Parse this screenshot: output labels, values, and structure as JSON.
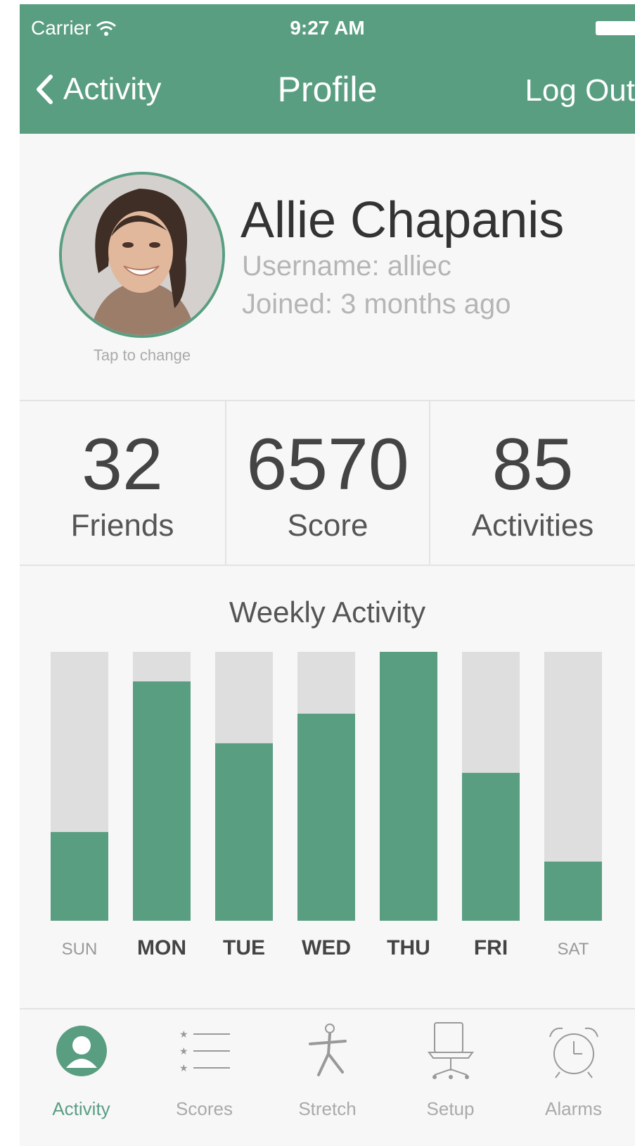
{
  "status_bar": {
    "carrier": "Carrier",
    "time": "9:27 AM"
  },
  "nav": {
    "back_label": "Activity",
    "title": "Profile",
    "logout_label": "Log Out"
  },
  "profile": {
    "name": "Allie Chapanis",
    "username": "Username: alliec",
    "joined": "Joined: 3 months ago",
    "tap_to_change": "Tap to change"
  },
  "stats": [
    {
      "value": "32",
      "label": "Friends"
    },
    {
      "value": "6570",
      "label": "Score"
    },
    {
      "value": "85",
      "label": "Activities"
    }
  ],
  "weekly_activity": {
    "title": "Weekly Activity",
    "bar_color": "#5a9e82",
    "track_color": "#dedede"
  },
  "chart_data": {
    "type": "bar",
    "title": "Weekly Activity",
    "categories": [
      "SUN",
      "MON",
      "TUE",
      "WED",
      "THU",
      "FRI",
      "SAT"
    ],
    "values": [
      0.33,
      0.89,
      0.66,
      0.77,
      1.0,
      0.55,
      0.22
    ],
    "highlighted": [
      false,
      true,
      true,
      true,
      true,
      true,
      false
    ],
    "ylim": [
      0,
      1
    ]
  },
  "tabbar": {
    "tabs": [
      {
        "label": "Activity",
        "icon": "person-icon",
        "active": true
      },
      {
        "label": "Scores",
        "icon": "list-icon",
        "active": false
      },
      {
        "label": "Stretch",
        "icon": "stretch-icon",
        "active": false
      },
      {
        "label": "Setup",
        "icon": "chair-icon",
        "active": false
      },
      {
        "label": "Alarms",
        "icon": "alarm-clock-icon",
        "active": false
      }
    ]
  },
  "colors": {
    "accent": "#5a9e82",
    "background": "#f7f7f7"
  }
}
